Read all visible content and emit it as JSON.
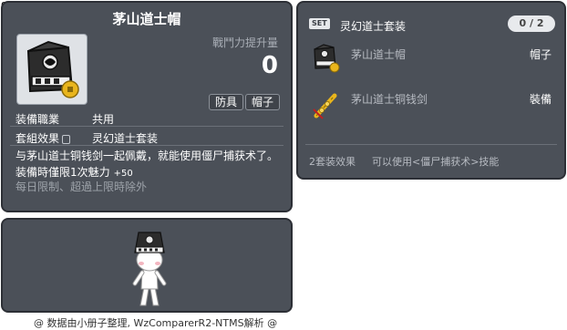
{
  "item_id": "01003458",
  "item": {
    "name": "茅山道士帽",
    "attack_label": "戰鬥力提升量",
    "attack_value": "0",
    "categories": [
      "防具",
      "帽子"
    ],
    "job_label": "装備職業",
    "job_value": "共用",
    "set_label": "套組效果",
    "set_value": "灵幻道士套装",
    "description": "与茅山道士铜钱剑一起佩戴，就能使用僵尸捕获术了。",
    "equip_stat_label": "装備時僅限1次魅力",
    "equip_stat_value": "+50",
    "limit_note": "每日限制、超過上限時除外"
  },
  "set": {
    "badge": "SET",
    "name": "灵幻道士套装",
    "count": "0 / 2",
    "items": [
      {
        "name": "茅山道士帽",
        "category": "帽子",
        "icon": "taoist-hat-icon"
      },
      {
        "name": "茅山道士铜钱剑",
        "category": "裝備",
        "icon": "coin-sword-icon"
      }
    ],
    "effect_label": "2套装效果",
    "effect_text": "可以使用<僵尸捕获术>技能"
  },
  "footer": "@ 数据由小册子整理, WzComparerR2-NTMS解析 @",
  "colors": {
    "panel_bg": "#4b5058",
    "panel_border": "#2c2f35",
    "muted_text": "#b7bbc2",
    "gold": "#e9b51c"
  }
}
